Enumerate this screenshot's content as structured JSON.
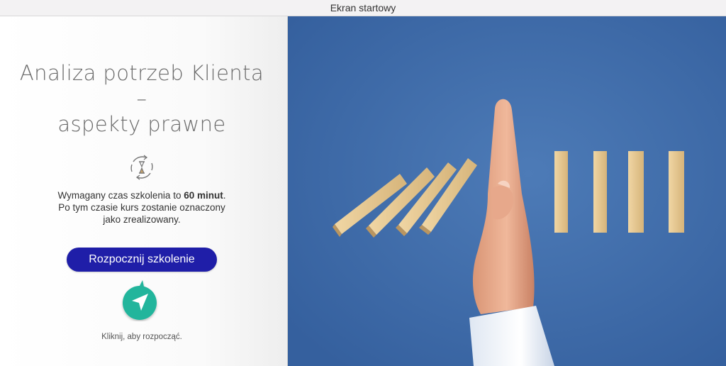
{
  "window": {
    "title": "Ekran startowy"
  },
  "course": {
    "title_line1": "Analiza potrzeb Klienta –",
    "title_line2": "aspekty prawne",
    "desc_prefix": "Wymagany czas szkolenia to ",
    "duration": "60 minut",
    "desc_suffix": ".",
    "desc_line2": "Po tym czasie kurs zostanie oznaczony",
    "desc_line3": "jako zrealizowany."
  },
  "actions": {
    "start_label": "Rozpocznij szkolenie",
    "hint": "Kliknij, aby rozpocząć."
  },
  "colors": {
    "accent": "#1f1ea8",
    "pointer_bg": "#20b59c",
    "photo_bg": "#3f6aa6"
  },
  "icons": [
    "hourglass-cycle-icon",
    "cursor-pointer-icon"
  ]
}
